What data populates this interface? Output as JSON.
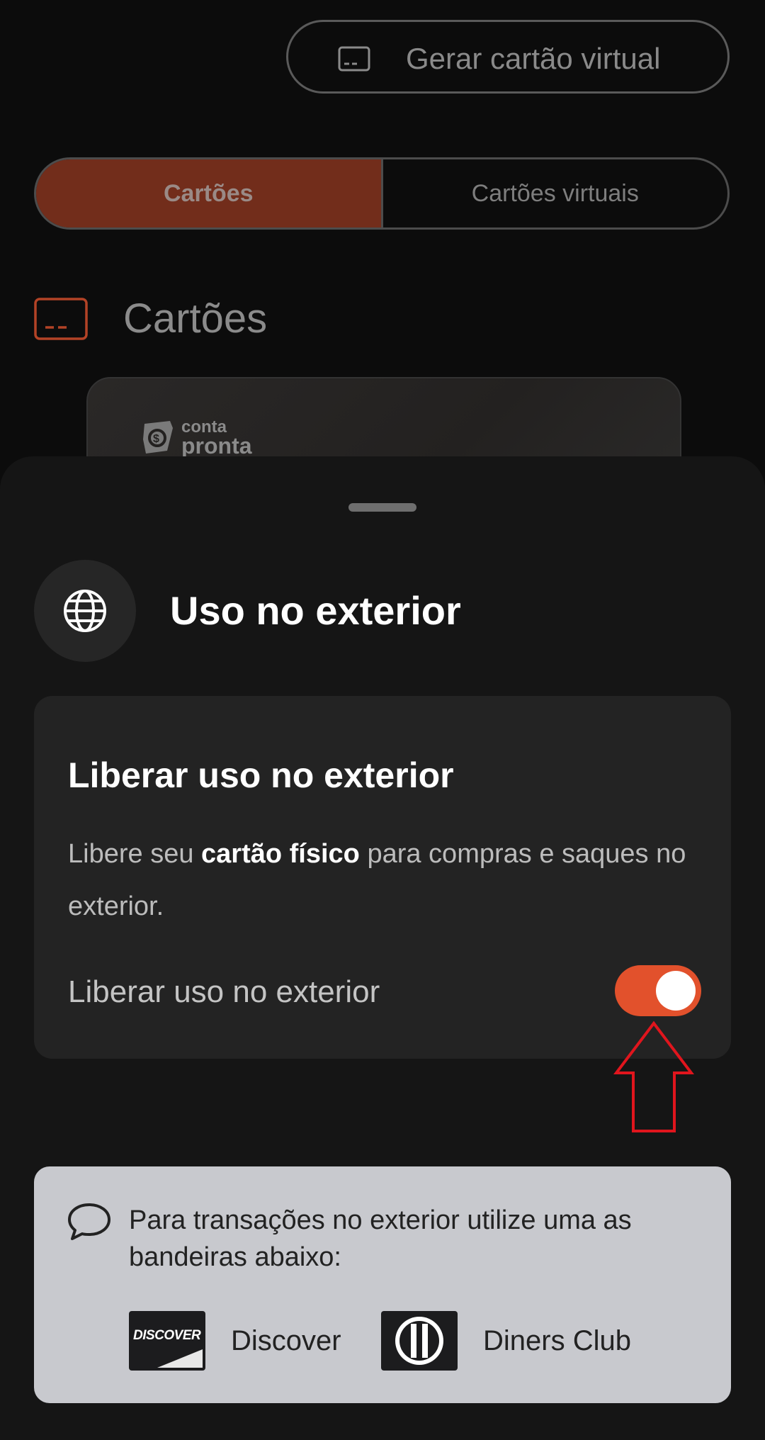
{
  "header": {
    "generate_virtual_card_label": "Gerar cartão virtual"
  },
  "tabs": [
    {
      "label": "Cartões",
      "active": true
    },
    {
      "label": "Cartões virtuais",
      "active": false
    }
  ],
  "section": {
    "title": "Cartões"
  },
  "card_preview": {
    "logo_line1": "conta",
    "logo_line2": "pronta"
  },
  "sheet": {
    "title": "Uso no exterior",
    "option": {
      "heading": "Liberar uso no exterior",
      "desc_prefix": "Libere seu ",
      "desc_bold": "cartão físico",
      "desc_suffix": " para compras e saques no exterior.",
      "toggle_label": "Liberar uso no exterior",
      "toggle_on": true
    },
    "info": {
      "message": "Para transações no exterior utilize uma as bandeiras abaixo:",
      "brands": [
        {
          "name": "Discover",
          "logo_text": "DISCOVER",
          "icon": "discover-logo"
        },
        {
          "name": "Diners Club",
          "icon": "diners-club-logo"
        }
      ]
    }
  },
  "colors": {
    "accent": "#e2512c",
    "tab_active": "#722d1b",
    "annotation_arrow": "#e0151d"
  }
}
